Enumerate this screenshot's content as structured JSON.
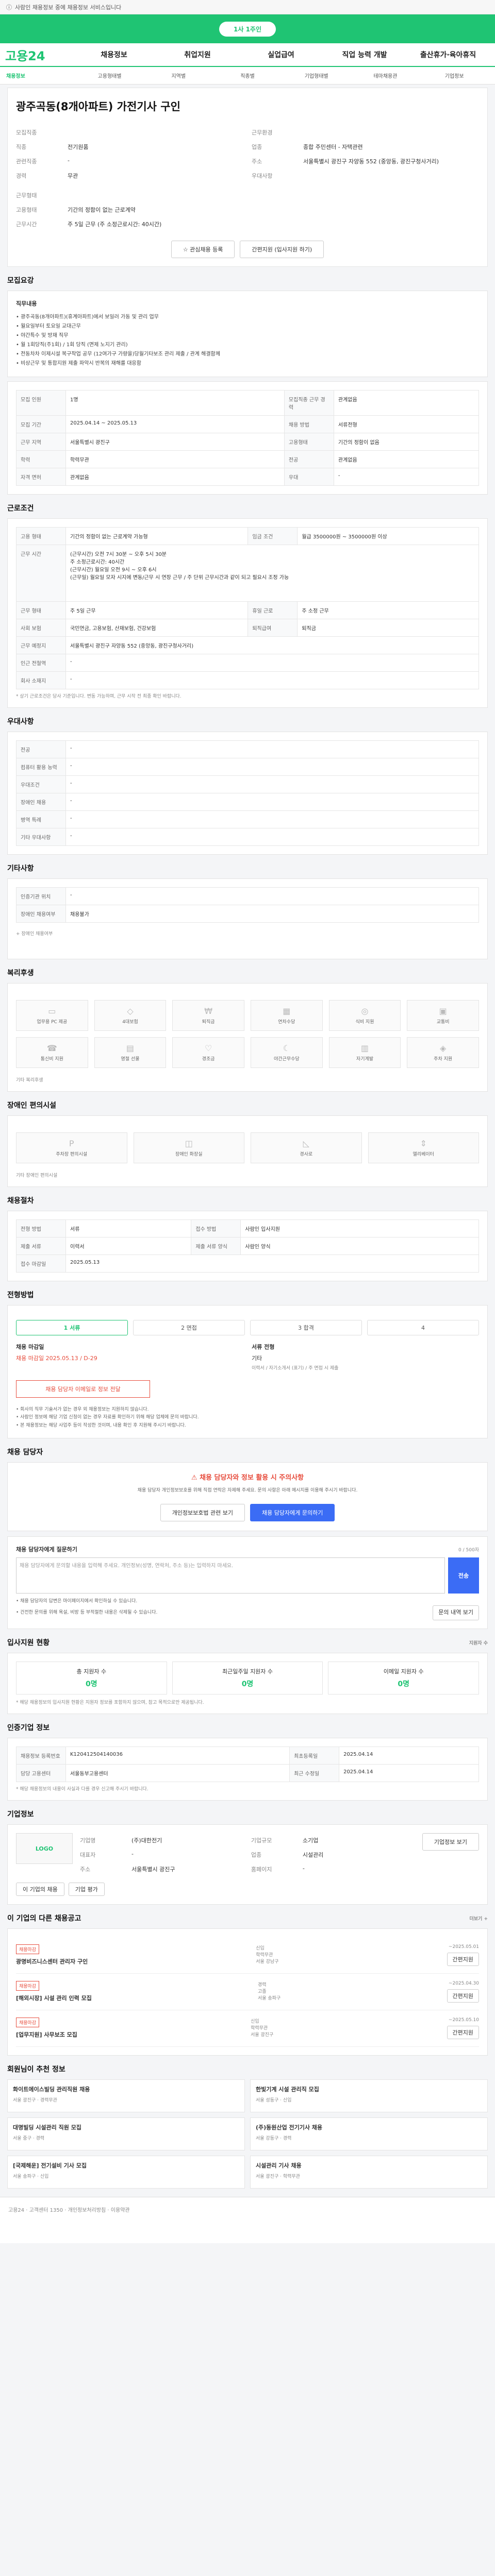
{
  "topbar": {
    "text": "사람인 채용정보 중에 채용정보 서비스입니다"
  },
  "banner": {
    "label": "1사 1주인"
  },
  "gnb": {
    "logo": "고용24",
    "items": [
      "채용정보",
      "취업지원",
      "실업급여",
      "직업 능력 개발",
      "출산휴가·육아휴직"
    ]
  },
  "subnav": [
    "채용정보",
    "고용형태별",
    "지역별",
    "직종별",
    "기업형태별",
    "테마채용관",
    "기업정보"
  ],
  "job": {
    "title": "광주곡동(8개아파트) 가전기사 구인"
  },
  "recruit_info": {
    "left": [
      {
        "k": "모집직종",
        "v": ""
      },
      {
        "k": "직종",
        "v": "전기원품"
      },
      {
        "k": "관련직종",
        "v": "-"
      },
      {
        "k": "경력",
        "v": "무관"
      }
    ],
    "right": [
      {
        "k": "근무환경",
        "v": ""
      },
      {
        "k": "업종",
        "v": "종합 주민센터 - 자택관련"
      },
      {
        "k": "주소",
        "v": "서울특별시 광진구 자양동 552 (중앙동, 광진구청사거리)"
      },
      {
        "k": "우대사항",
        "v": ""
      }
    ],
    "extra": [
      {
        "k": "근무형태",
        "v": ""
      },
      {
        "k": "고용형태",
        "v": "기간의 정함이 없는 근로계약"
      },
      {
        "k": "근무시간",
        "v": "주 5일 근무 (주 소정근로시간: 40시간)"
      }
    ]
  },
  "buttons": {
    "scrap": "관심채용 등록",
    "apply": "간편지원 (입사지원 하기)"
  },
  "detail": {
    "title": "모집요강",
    "sub": "직무내용",
    "bullets": [
      "• 광주곡동(8개아파트)(휴계아파트)에서 보일러 가동 및 관리 업무",
      "• 월요일부터 토요일 교대근무",
      "• 야간특수 및 방재 직무",
      "• 월 1회당직(주1회) / 1회 당직 (면제 노지기 관리)",
      "• 전동차차 이제시설 복구작업 공무 (12여가구 가량을)당월기타보조 관리 제출 / 관계 해결함께",
      "• 비상근무 및 통합지원 제출 파악시 반복의 재해를 대응함"
    ]
  },
  "conditions": [
    {
      "k": "모집 인원",
      "v": "1명",
      "k2": "모집직종 근무 경력",
      "v2": "관계없음"
    },
    {
      "k": "모집 기간",
      "v": "2025.04.14 ~ 2025.05.13",
      "k2": "채용 방법",
      "v2": "서류전형"
    },
    {
      "k": "근무 지역",
      "v": "서울특별시 광진구",
      "k2": "고용형태",
      "v2": "기간의 정함이 없음"
    },
    {
      "k": "학력",
      "v": "학력무관",
      "k2": "전공",
      "v2": "관계없음"
    },
    {
      "k": "자격 면허",
      "v": "관계없음",
      "k2": "우대",
      "v2": "-"
    }
  ],
  "worksection": {
    "title": "근로조건",
    "rows": [
      {
        "k": "고용 형태",
        "v": "기간의 정함이 없는 근로계약  가능형",
        "k2": "임금 조건",
        "v2": "월급 3500000원 ~ 3500000원 이상"
      },
      {
        "k": "근무 시간",
        "v": "(근무시간) 오전 7시 30분 ~ 오후 5시 30분\n주 소정근로시간: 40시간\n(근무시간) 월요일 오전 9시 ~ 오후 6시\n(근무일) 월요일 모자 시지에 변동/근무 시 연장 근무 / 주 단위 근무시간과 같이 되고 필요시 조정 가능"
      },
      {
        "k": "근무 형태",
        "v": "주 5일 근무",
        "k2": "휴일 근로",
        "v2": "주 소정 근무"
      },
      {
        "k": "사회 보험",
        "v": "국민연금, 고용보험, 산재보험, 건강보험",
        "k2": "퇴직급여",
        "v2": "퇴직금"
      },
      {
        "k": "근무 예정지",
        "v": "서울특별시 광진구 자양동 552 (중앙동, 광진구청사거리)"
      },
      {
        "k": "인근 전철역",
        "v": "-"
      },
      {
        "k": "회사 소재지",
        "v": "-"
      }
    ],
    "footnote": "* 상기 근로조건은 당사 기준입니다. 변동 가능하며, 근무 시작 전 최종 확인 바랍니다."
  },
  "welfare_top": {
    "title": "우대사항",
    "rows": [
      {
        "k": "전공",
        "v": "-"
      },
      {
        "k": "컴퓨터 활용 능력",
        "v": "-"
      },
      {
        "k": "우대조건",
        "v": "-"
      },
      {
        "k": "장애인 채용",
        "v": "-"
      },
      {
        "k": "병역 특례",
        "v": "-"
      },
      {
        "k": "기타 우대사항",
        "v": "-"
      }
    ]
  },
  "etc": {
    "title": "기타사항",
    "rows": [
      {
        "k": "인증기관 위치",
        "v": "-"
      },
      {
        "k": "장애인 채용여부",
        "v": "채용불가"
      }
    ],
    "note": "+ 장애인 채용여부"
  },
  "benefits": {
    "title": "복리후생",
    "items": [
      "업무용 PC 제공",
      "4대보험",
      "퇴직금",
      "연차수당",
      "식비 지원",
      "교통비",
      "통신비 지원",
      "명절 선물",
      "경조금",
      "야간근무수당",
      "자기계발",
      "주차 지원"
    ],
    "footer": "기타 복리후생"
  },
  "disabled": {
    "title": "장애인 편의시설",
    "items": [
      "주차장 편의시설",
      "장애인 화장실",
      "경사로",
      "엘리베이터"
    ],
    "footer": "기타 장애인 편의시설"
  },
  "apply_method": {
    "title": "채용절차",
    "rows": [
      {
        "k": "전형 방법",
        "v": "서류",
        "k2": "접수 방법",
        "v2": "사람인 입사지원"
      },
      {
        "k": "제출 서류",
        "v": "이력서",
        "k2": "제출 서류 양식",
        "v2": "사람인 양식"
      },
      {
        "k": "접수 마감일",
        "v": "2025.05.13",
        "k2": "",
        "v2": ""
      }
    ]
  },
  "process": {
    "title": "전형방법",
    "steps": [
      "1 서류",
      "2 면접",
      "3 합격",
      "4"
    ],
    "deadline_label": "채용 마감일",
    "deadline_value": "채용 마감일 2025.05.13 / D-29",
    "detail_label": "서류 전형",
    "detail_value": "기타",
    "detail_note": "이력서 / 자기소개서 (표기) / 주 면접 시 제출",
    "redbox": "채용 담당자 이메일로 정보 전달",
    "notes": [
      "• 회사의 직무 기술서가 없는 경우 외 채용정보는 지원하지 않습니다.",
      "• 사람인 정보에 해당 기업 신청이 없는 경우 자료를 확인하기 위해 해당 업체에 문의 바랍니다.",
      "• 본 채용정보는 해당 사업주 등이 작성한 것이며, 내용 확인 후 지원해 주시기 바랍니다."
    ]
  },
  "contact": {
    "title": "채용 담당자",
    "warn_title": "채용 담당자와 정보 활용 시 주의사항",
    "warn_body": "채용 담당자 개인정보보호를 위해 직접 연락은 자제해 주세요. 문의 사항은 아래 메시지를 이용해 주시기 바랍니다.",
    "btn1": "개인정보보호법 관련 보기",
    "btn2": "채용 담당자에게 문의하기",
    "ask_title": "채용 담당자에게 질문하기",
    "ask_counter": "0 / 500자",
    "ask_placeholder": "채용 담당자에게 문의할 내용을 입력해 주세요. 개인정보(성명, 연락처, 주소 등)는 입력하지 마세요.",
    "ask_send": "전송",
    "ask_note": "• 채용 담당자의 답변은 마이페이지에서 확인하실 수 있습니다.",
    "ask_note2": "• 건전한 문의를 위해 욕설, 비방 등 부적절한 내용은 삭제될 수 있습니다.",
    "reply_btn": "문의 내역 보기"
  },
  "company": {
    "title": "입사지원 현황",
    "count_label": "지원자 수",
    "cells": [
      {
        "k": "총 지원자 수",
        "v": "0명"
      },
      {
        "k": "최근일주일 지원자 수",
        "v": "0명"
      },
      {
        "k": "이메일 지원자 수",
        "v": "0명"
      }
    ],
    "note": "* 해당 채용정보의 입사지원 현황은 지원자 정보를 포함하지 않으며, 참고 목적으로만 제공됩니다."
  },
  "intro": {
    "title": "인증기업 정보",
    "rows": [
      {
        "k": "채용정보 등록번호",
        "v": "K120412504140036",
        "k2": "최초등록일",
        "v2": "2025.04.14"
      },
      {
        "k": "담당 고용센터",
        "v": "서울동부고용센터",
        "k2": "최근 수정일",
        "v2": "2025.04.14"
      }
    ],
    "note": "* 해당 채용정보의 내용이 사실과 다를 경우 신고해 주시기 바랍니다."
  },
  "companyinfo": {
    "title": "기업정보",
    "logo": "LOGO",
    "name_label": "기업명",
    "name": "(주)대한전기",
    "rep_label": "대표자",
    "rep": "-",
    "addr_label": "주소",
    "addr": "서울특별시 광진구",
    "size_label": "기업규모",
    "size": "소기업",
    "biz_label": "업종",
    "biz": "시설관리",
    "home_label": "홈페이지",
    "home": "-",
    "btn": "기업정보 보기",
    "link1": "이 기업의 채용",
    "link2": "기업 평가"
  },
  "otherjobs": {
    "title": "이 기업의 다른 채용공고",
    "more": "더보기 +",
    "items": [
      {
        "badge": "채용마감",
        "title": "광명비즈니스센터 관리자 구인",
        "meta1": "신입",
        "meta2": "학력무관",
        "meta3": "서울 강남구",
        "date": "~2025.05.01",
        "btn": "간편지원"
      },
      {
        "badge": "채용마감",
        "title": "[해외시장] 시설 관리 인력 모집",
        "meta1": "경력",
        "meta2": "고졸",
        "meta3": "서울 송파구",
        "date": "~2025.04.30",
        "btn": "간편지원"
      },
      {
        "badge": "채용마감",
        "title": "[업무지원] 사무보조 모집",
        "meta1": "신입",
        "meta2": "학력무관",
        "meta3": "서울 광진구",
        "date": "~2025.05.10",
        "btn": "간편지원"
      }
    ]
  },
  "recommend": {
    "title": "회원님이 추천 정보",
    "items": [
      {
        "title": "화이트에이스빌딩 관리직원 채용",
        "meta": "서울 광진구 · 경력무관"
      },
      {
        "title": "한빛기계 시설 관리직 모집",
        "meta": "서울 성동구 · 신입"
      },
      {
        "title": "대명빌딩 시설관리 직원 모집",
        "meta": "서울 중구 · 경력"
      },
      {
        "title": "(주)동원산업 전기기사 채용",
        "meta": "서울 강동구 · 경력"
      },
      {
        "title": "[국제해운] 전기설비 기사 모집",
        "meta": "서울 송파구 · 신입"
      },
      {
        "title": "시설관리 기사 채용",
        "meta": "서울 광진구 · 학력무관"
      }
    ]
  },
  "footer": {
    "text": "고용24 · 고객센터 1350 · 개인정보처리방침 · 이용약관"
  }
}
